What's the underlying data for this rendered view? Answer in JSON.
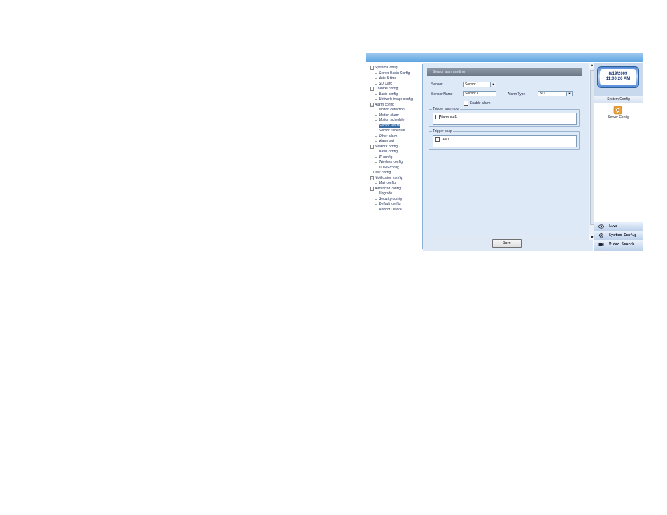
{
  "tree": [
    {
      "label": "System Config",
      "level": 0,
      "box": "-"
    },
    {
      "label": "Server Basic Config",
      "level": 1
    },
    {
      "label": "date & time",
      "level": 1
    },
    {
      "label": "SD Card",
      "level": 1
    },
    {
      "label": "Channel config",
      "level": 0,
      "box": "-"
    },
    {
      "label": "Basic config",
      "level": 1
    },
    {
      "label": "Network image config",
      "level": 1
    },
    {
      "label": "Alarm config",
      "level": 0,
      "box": "-"
    },
    {
      "label": "Motion detection",
      "level": 1
    },
    {
      "label": "Motion alarm",
      "level": 1
    },
    {
      "label": "Motion schedule",
      "level": 1
    },
    {
      "label": "Sensor alarm",
      "level": 1,
      "selected": true
    },
    {
      "label": "Sensor schedule",
      "level": 1
    },
    {
      "label": "Other alarm",
      "level": 1
    },
    {
      "label": "Alarm out",
      "level": 1
    },
    {
      "label": "Network config",
      "level": 0,
      "box": "-"
    },
    {
      "label": "Basic config",
      "level": 1
    },
    {
      "label": "IP config",
      "level": 1
    },
    {
      "label": "Wireless config",
      "level": 1
    },
    {
      "label": "DDNS config",
      "level": 1
    },
    {
      "label": "User config",
      "level": 0
    },
    {
      "label": "Notification config",
      "level": 0,
      "box": "-"
    },
    {
      "label": "Mail config",
      "level": 1
    },
    {
      "label": "Advanced config",
      "level": 0,
      "box": "-"
    },
    {
      "label": "Upgrade",
      "level": 1
    },
    {
      "label": "Security config",
      "level": 1
    },
    {
      "label": "Default config",
      "level": 1
    },
    {
      "label": "Reboot Device",
      "level": 1
    }
  ],
  "main": {
    "section_title": "Sensor alarm setting",
    "sensor_label": "Sensor",
    "sensor_value": "Sensor 1",
    "sensor_name_label": "Sensor Name :",
    "sensor_name_value": "Sensor1",
    "alarm_type_label": "Alarm Type",
    "alarm_type_value": "NO",
    "enable_alarm_label": "Enable alarm",
    "trigger_alarm_out_legend": "Trigger alarm out",
    "trigger_alarm_out_item": "Alarm out1",
    "trigger_snap_legend": "Trigger snap",
    "trigger_snap_item": "CAM1",
    "save_label": "Save"
  },
  "right": {
    "date": "8/19/2009",
    "time": "11:00:26 AM",
    "tab_label": "System Config",
    "server_config_label": "Server Config",
    "nav": [
      {
        "label": "Live",
        "icon": "eye-icon"
      },
      {
        "label": "System Config",
        "icon": "gear-icon"
      },
      {
        "label": "Video Search",
        "icon": "camera-icon"
      }
    ]
  }
}
